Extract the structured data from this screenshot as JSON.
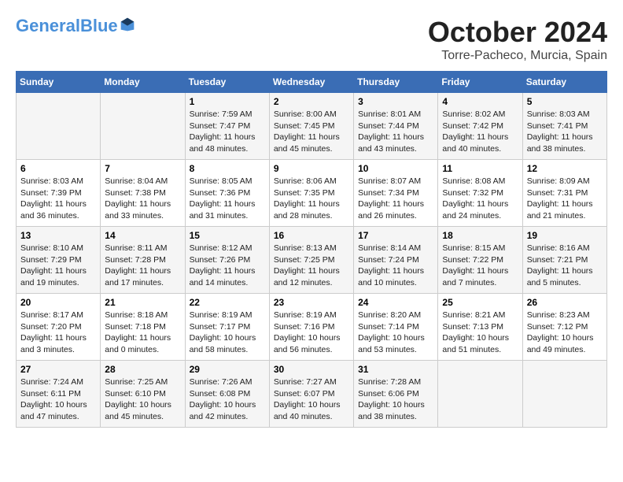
{
  "header": {
    "logo_general": "General",
    "logo_blue": "Blue",
    "month": "October 2024",
    "location": "Torre-Pacheco, Murcia, Spain"
  },
  "days_of_week": [
    "Sunday",
    "Monday",
    "Tuesday",
    "Wednesday",
    "Thursday",
    "Friday",
    "Saturday"
  ],
  "weeks": [
    [
      {
        "day": "",
        "content": ""
      },
      {
        "day": "",
        "content": ""
      },
      {
        "day": "1",
        "content": "Sunrise: 7:59 AM\nSunset: 7:47 PM\nDaylight: 11 hours and 48 minutes."
      },
      {
        "day": "2",
        "content": "Sunrise: 8:00 AM\nSunset: 7:45 PM\nDaylight: 11 hours and 45 minutes."
      },
      {
        "day": "3",
        "content": "Sunrise: 8:01 AM\nSunset: 7:44 PM\nDaylight: 11 hours and 43 minutes."
      },
      {
        "day": "4",
        "content": "Sunrise: 8:02 AM\nSunset: 7:42 PM\nDaylight: 11 hours and 40 minutes."
      },
      {
        "day": "5",
        "content": "Sunrise: 8:03 AM\nSunset: 7:41 PM\nDaylight: 11 hours and 38 minutes."
      }
    ],
    [
      {
        "day": "6",
        "content": "Sunrise: 8:03 AM\nSunset: 7:39 PM\nDaylight: 11 hours and 36 minutes."
      },
      {
        "day": "7",
        "content": "Sunrise: 8:04 AM\nSunset: 7:38 PM\nDaylight: 11 hours and 33 minutes."
      },
      {
        "day": "8",
        "content": "Sunrise: 8:05 AM\nSunset: 7:36 PM\nDaylight: 11 hours and 31 minutes."
      },
      {
        "day": "9",
        "content": "Sunrise: 8:06 AM\nSunset: 7:35 PM\nDaylight: 11 hours and 28 minutes."
      },
      {
        "day": "10",
        "content": "Sunrise: 8:07 AM\nSunset: 7:34 PM\nDaylight: 11 hours and 26 minutes."
      },
      {
        "day": "11",
        "content": "Sunrise: 8:08 AM\nSunset: 7:32 PM\nDaylight: 11 hours and 24 minutes."
      },
      {
        "day": "12",
        "content": "Sunrise: 8:09 AM\nSunset: 7:31 PM\nDaylight: 11 hours and 21 minutes."
      }
    ],
    [
      {
        "day": "13",
        "content": "Sunrise: 8:10 AM\nSunset: 7:29 PM\nDaylight: 11 hours and 19 minutes."
      },
      {
        "day": "14",
        "content": "Sunrise: 8:11 AM\nSunset: 7:28 PM\nDaylight: 11 hours and 17 minutes."
      },
      {
        "day": "15",
        "content": "Sunrise: 8:12 AM\nSunset: 7:26 PM\nDaylight: 11 hours and 14 minutes."
      },
      {
        "day": "16",
        "content": "Sunrise: 8:13 AM\nSunset: 7:25 PM\nDaylight: 11 hours and 12 minutes."
      },
      {
        "day": "17",
        "content": "Sunrise: 8:14 AM\nSunset: 7:24 PM\nDaylight: 11 hours and 10 minutes."
      },
      {
        "day": "18",
        "content": "Sunrise: 8:15 AM\nSunset: 7:22 PM\nDaylight: 11 hours and 7 minutes."
      },
      {
        "day": "19",
        "content": "Sunrise: 8:16 AM\nSunset: 7:21 PM\nDaylight: 11 hours and 5 minutes."
      }
    ],
    [
      {
        "day": "20",
        "content": "Sunrise: 8:17 AM\nSunset: 7:20 PM\nDaylight: 11 hours and 3 minutes."
      },
      {
        "day": "21",
        "content": "Sunrise: 8:18 AM\nSunset: 7:18 PM\nDaylight: 11 hours and 0 minutes."
      },
      {
        "day": "22",
        "content": "Sunrise: 8:19 AM\nSunset: 7:17 PM\nDaylight: 10 hours and 58 minutes."
      },
      {
        "day": "23",
        "content": "Sunrise: 8:19 AM\nSunset: 7:16 PM\nDaylight: 10 hours and 56 minutes."
      },
      {
        "day": "24",
        "content": "Sunrise: 8:20 AM\nSunset: 7:14 PM\nDaylight: 10 hours and 53 minutes."
      },
      {
        "day": "25",
        "content": "Sunrise: 8:21 AM\nSunset: 7:13 PM\nDaylight: 10 hours and 51 minutes."
      },
      {
        "day": "26",
        "content": "Sunrise: 8:23 AM\nSunset: 7:12 PM\nDaylight: 10 hours and 49 minutes."
      }
    ],
    [
      {
        "day": "27",
        "content": "Sunrise: 7:24 AM\nSunset: 6:11 PM\nDaylight: 10 hours and 47 minutes."
      },
      {
        "day": "28",
        "content": "Sunrise: 7:25 AM\nSunset: 6:10 PM\nDaylight: 10 hours and 45 minutes."
      },
      {
        "day": "29",
        "content": "Sunrise: 7:26 AM\nSunset: 6:08 PM\nDaylight: 10 hours and 42 minutes."
      },
      {
        "day": "30",
        "content": "Sunrise: 7:27 AM\nSunset: 6:07 PM\nDaylight: 10 hours and 40 minutes."
      },
      {
        "day": "31",
        "content": "Sunrise: 7:28 AM\nSunset: 6:06 PM\nDaylight: 10 hours and 38 minutes."
      },
      {
        "day": "",
        "content": ""
      },
      {
        "day": "",
        "content": ""
      }
    ]
  ]
}
